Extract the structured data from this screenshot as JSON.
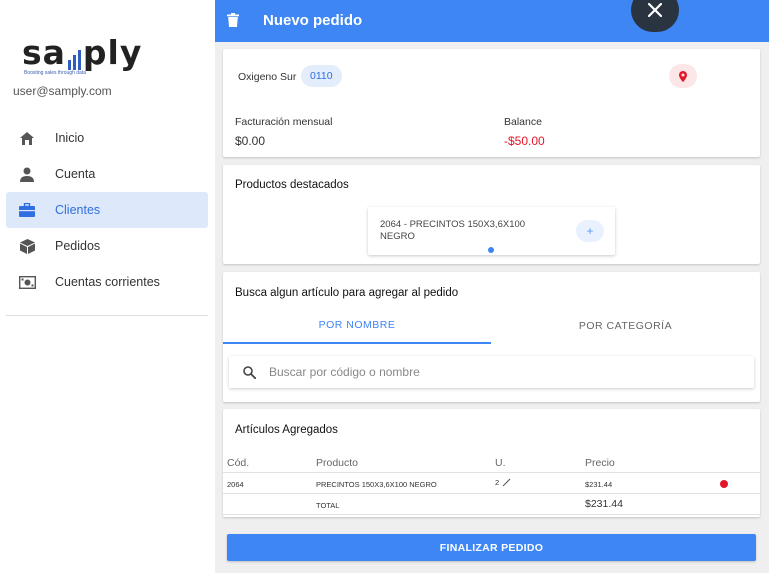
{
  "sidebar": {
    "logo_text": "samply",
    "logo_tagline": "Boosting sales through data",
    "user_email": "user@samply.com",
    "items": [
      {
        "label": "Inicio",
        "icon": "home-icon"
      },
      {
        "label": "Cuenta",
        "icon": "person-icon"
      },
      {
        "label": "Clientes",
        "icon": "briefcase-icon",
        "active": true
      },
      {
        "label": "Pedidos",
        "icon": "box-icon"
      },
      {
        "label": "Cuentas corrientes",
        "icon": "money-icon"
      }
    ]
  },
  "header": {
    "title": "Nuevo pedido",
    "delete_icon": "trash-icon",
    "close_icon": "close-icon"
  },
  "client": {
    "name": "Oxigeno Sur",
    "code": "0110",
    "location_icon": "map-pin-icon",
    "billing_label": "Facturación mensual",
    "billing_value": "$0.00",
    "balance_label": "Balance",
    "balance_value": "-$50.00"
  },
  "featured": {
    "heading": "Productos destacados",
    "product": "2064 - PRECINTOS 150X3,6X100 NEGRO",
    "add_label": "+"
  },
  "search": {
    "heading": "Busca algun artículo para agregar al pedido",
    "tabs": [
      "POR NOMBRE",
      "POR CATEGORÍA"
    ],
    "placeholder": "Buscar por código o nombre"
  },
  "items": {
    "heading": "Artículos Agregados",
    "columns": [
      "Cód.",
      "Producto",
      "U.",
      "Precio"
    ],
    "rows": [
      {
        "code": "2064",
        "product": "PRECINTOS 150X3,6X100 NEGRO",
        "units": "2",
        "price": "$231.44"
      }
    ],
    "total_label": "TOTAL",
    "total_value": "$231.44"
  },
  "finalize_label": "FINALIZAR PEDIDO",
  "colors": {
    "accent": "#3d86f4",
    "negative": "#e3162a",
    "active_bg": "#dde9fb"
  }
}
